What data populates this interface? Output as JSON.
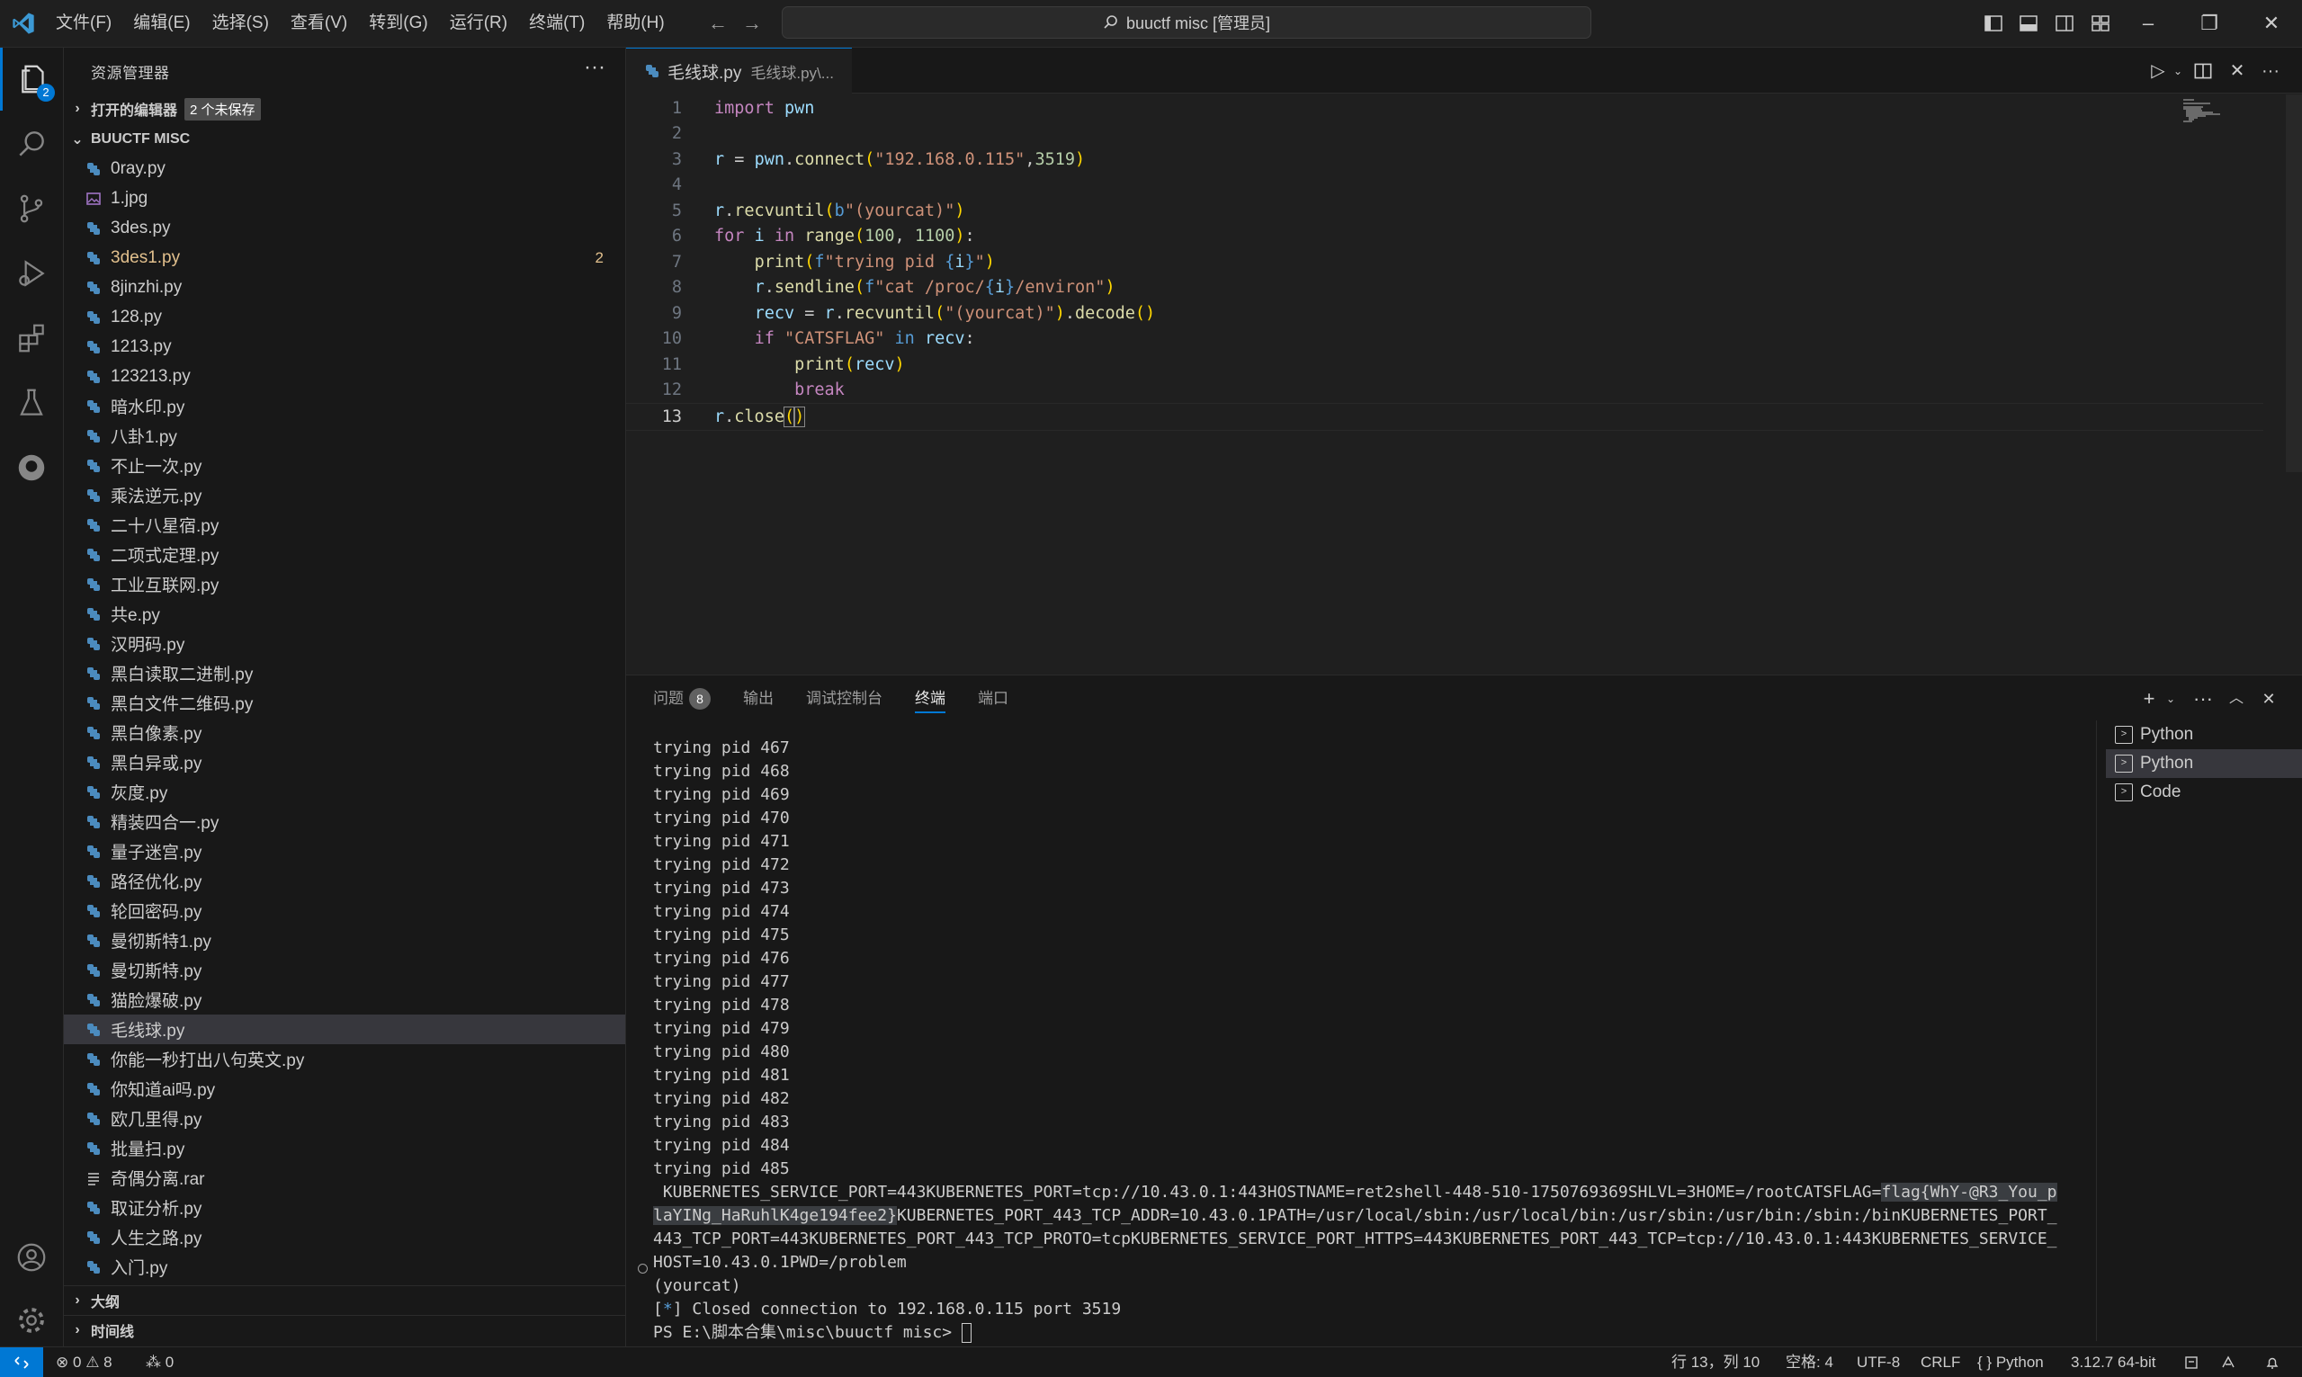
{
  "titlebar": {
    "menu": [
      "文件(F)",
      "编辑(E)",
      "选择(S)",
      "查看(V)",
      "转到(G)",
      "运行(R)",
      "终端(T)",
      "帮助(H)"
    ],
    "search_text": "buuctf misc [管理员]"
  },
  "activity": {
    "explorer_badge": "2"
  },
  "sidebar": {
    "title": "资源管理器",
    "open_editors_label": "打开的编辑器",
    "unsaved_badge": "2 个未保存",
    "folder_label": "BUUCTF MISC",
    "files": [
      {
        "name": "0ray.py"
      },
      {
        "name": "1.jpg"
      },
      {
        "name": "3des.py"
      },
      {
        "name": "3des1.py",
        "count": "2"
      },
      {
        "name": "8jinzhi.py"
      },
      {
        "name": "128.py"
      },
      {
        "name": "1213.py"
      },
      {
        "name": "123213.py"
      },
      {
        "name": "暗水印.py"
      },
      {
        "name": "八卦1.py"
      },
      {
        "name": "不止一次.py"
      },
      {
        "name": "乘法逆元.py"
      },
      {
        "name": "二十八星宿.py"
      },
      {
        "name": "二项式定理.py"
      },
      {
        "name": "工业互联网.py"
      },
      {
        "name": "共e.py"
      },
      {
        "name": "汉明码.py"
      },
      {
        "name": "黑白读取二进制.py"
      },
      {
        "name": "黑白文件二维码.py"
      },
      {
        "name": "黑白像素.py"
      },
      {
        "name": "黑白异或.py"
      },
      {
        "name": "灰度.py"
      },
      {
        "name": "精装四合一.py"
      },
      {
        "name": "量子迷宫.py"
      },
      {
        "name": "路径优化.py"
      },
      {
        "name": "轮回密码.py"
      },
      {
        "name": "曼彻斯特1.py"
      },
      {
        "name": "曼切斯特.py"
      },
      {
        "name": "猫脸爆破.py"
      },
      {
        "name": "毛线球.py"
      },
      {
        "name": "你能一秒打出八句英文.py"
      },
      {
        "name": "你知道ai吗.py"
      },
      {
        "name": "欧几里得.py"
      },
      {
        "name": "批量扫.py"
      },
      {
        "name": "奇偶分离.rar"
      },
      {
        "name": "取证分析.py"
      },
      {
        "name": "人生之路.py"
      },
      {
        "name": "入门.py"
      }
    ],
    "outline_label": "大纲",
    "timeline_label": "时间线"
  },
  "editor": {
    "tab_name": "毛线球.py",
    "tab_desc": "毛线球.py\\...",
    "line_numbers": [
      "1",
      "2",
      "3",
      "4",
      "5",
      "6",
      "7",
      "8",
      "9",
      "10",
      "11",
      "12",
      "13"
    ]
  },
  "panel": {
    "tabs": [
      "问题",
      "输出",
      "调试控制台",
      "终端",
      "端口"
    ],
    "problems_count": "8",
    "terminal_lines": [
      "trying pid 467",
      "trying pid 468",
      "trying pid 469",
      "trying pid 470",
      "trying pid 471",
      "trying pid 472",
      "trying pid 473",
      "trying pid 474",
      "trying pid 475",
      "trying pid 476",
      "trying pid 477",
      "trying pid 478",
      "trying pid 479",
      "trying pid 480",
      "trying pid 481",
      "trying pid 482",
      "trying pid 483",
      "trying pid 484",
      "trying pid 485"
    ],
    "env_line1_a": " KUBERNETES_SERVICE_PORT=443KUBERNETES_PORT=tcp://10.43.0.1:443HOSTNAME=ret2shell-448-510-1750769369SHLVL=3HOME=/rootCATSFLAG=",
    "env_line1_flag": "flag{WhY-@R3_You_p",
    "env_line2_flag": "laYINg_HaRuhlK4ge194fee2}",
    "env_line2_b": "KUBERNETES_PORT_443_TCP_ADDR=10.43.0.1PATH=/usr/local/sbin:/usr/local/bin:/usr/sbin:/usr/bin:/sbin:/binKUBERNETES_PORT_",
    "env_line3": "443_TCP_PORT=443KUBERNETES_PORT_443_TCP_PROTO=tcpKUBERNETES_SERVICE_PORT_HTTPS=443KUBERNETES_PORT_443_TCP=tcp://10.43.0.1:443KUBERNETES_SERVICE_",
    "env_line4": "HOST=10.43.0.1PWD=/problem",
    "yourcat": "(yourcat)",
    "closed_prefix": "[",
    "closed_star": "*",
    "closed_rest": "] Closed connection to 192.168.0.115 port 3519",
    "prompt": "PS E:\\脚本合集\\misc\\buuctf misc> ",
    "terminals": [
      "Python",
      "Python",
      "Code"
    ]
  },
  "statusbar": {
    "errors": "0",
    "warnings": "8",
    "ports": "0",
    "position": "行 13，列 10",
    "spaces": "空格: 4",
    "encoding": "UTF-8",
    "eol": "CRLF",
    "language": "Python",
    "interpreter": "3.12.7 64-bit"
  },
  "colors": {
    "accent": "#0078d4",
    "modified": "#e2c08d"
  }
}
